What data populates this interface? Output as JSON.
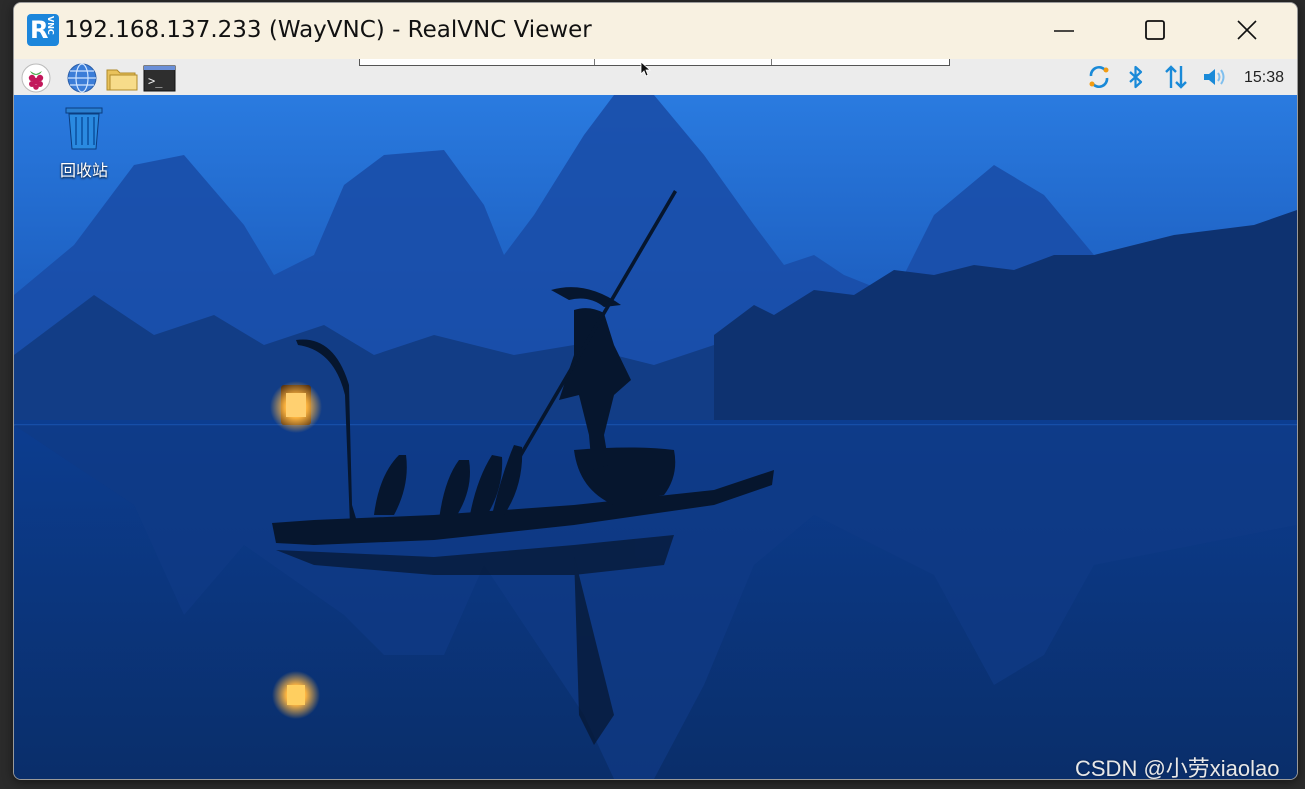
{
  "window": {
    "title": "192.168.137.233 (WayVNC) - RealVNC Viewer",
    "app_icon": "realvnc-logo-icon",
    "controls": [
      "minimize-icon",
      "maximize-icon",
      "close-icon"
    ]
  },
  "panel": {
    "launchers": [
      {
        "name": "raspberry-menu-icon"
      },
      {
        "name": "web-browser-icon"
      },
      {
        "name": "file-manager-icon"
      },
      {
        "name": "terminal-icon"
      }
    ],
    "tray": [
      {
        "name": "network-sync-icon"
      },
      {
        "name": "bluetooth-icon"
      },
      {
        "name": "network-updown-icon"
      },
      {
        "name": "volume-icon"
      }
    ],
    "clock": "15:38"
  },
  "desktop": {
    "icons": [
      {
        "name": "trash-icon",
        "label": "回收站"
      }
    ],
    "wallpaper": "cormorant-fisherman-river-night"
  },
  "watermark": "CSDN @小劳xiaolao",
  "colors": {
    "titlebar": "#f8f1e1",
    "panel": "#ececec",
    "accent": "#1c86db",
    "tray_blue": "#1a8ad8",
    "sky_top": "#1a66d0",
    "water": "#0a3a8a"
  }
}
